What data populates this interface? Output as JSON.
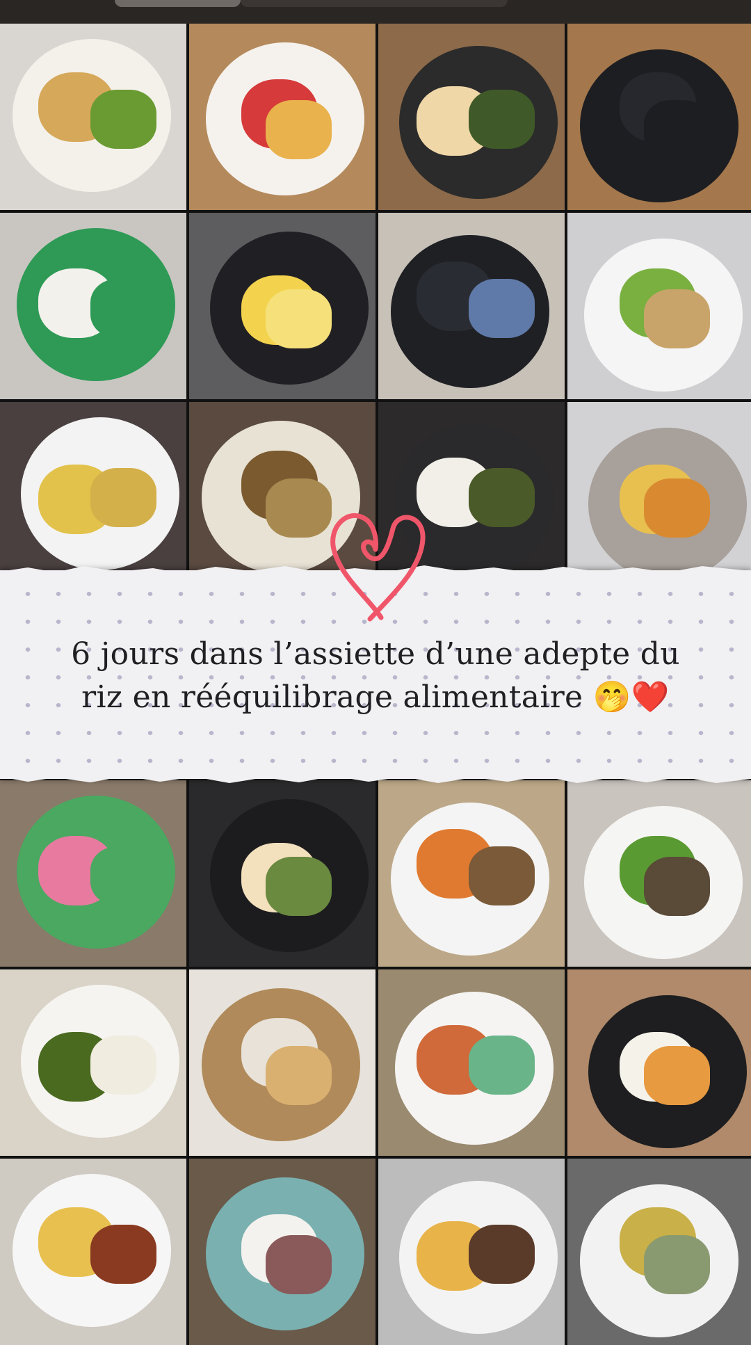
{
  "story": {
    "progress_fraction": 0.32,
    "caption_line1": "6 jours dans l’assiette d’une adepte du",
    "caption_line2": "riz en rééquilibrage alimentaire",
    "caption_emojis": "🤭❤️",
    "doodle_icon": "heart-doodle-icon"
  },
  "colors": {
    "banner_bg": "#f1f0f2",
    "dot": "#b8b6cc",
    "heart": "#f0566a",
    "text": "#1f1f24"
  },
  "tiles": [
    {
      "name": "meal-photo-chicken-salad-attieke",
      "bg": "#d9d6d2",
      "plate": "#f4f1ea",
      "food": "#d6a85a",
      "food2": "#6a9b32"
    },
    {
      "name": "meal-photo-omelette-watermelon",
      "bg": "#b48a5c",
      "plate": "#f5f2ee",
      "food": "#d63a3a",
      "food2": "#e9b24c"
    },
    {
      "name": "meal-photo-flan-greens",
      "bg": "#8c6a4a",
      "plate": "#2b2b2b",
      "food": "#f0d7a8",
      "food2": "#3f5a28"
    },
    {
      "name": "photo-empty-black-plate",
      "bg": "#a4784c",
      "plate": "#1d1e22",
      "food": "#26282d",
      "food2": "#1d1e22"
    },
    {
      "name": "photo-yogurt-dolait-nature",
      "bg": "#c9c6c2",
      "plate": "#2e9a55",
      "food": "#f3f1ec",
      "food2": "#2e9a55"
    },
    {
      "name": "meal-photo-pineapple-slices",
      "bg": "#5d5d60",
      "plate": "#202024",
      "food": "#f3d34e",
      "food2": "#f6e07a"
    },
    {
      "name": "photo-bathroom-scale",
      "bg": "#c7c1b8",
      "plate": "#1f2024",
      "food": "#2a2c33",
      "food2": "#5f7aa8"
    },
    {
      "name": "meal-photo-fish-avocado-salad",
      "bg": "#cfcfd2",
      "plate": "#f5f5f5",
      "food": "#7ab040",
      "food2": "#c9a46a"
    },
    {
      "name": "meal-photo-noodles-vegetables",
      "bg": "#4a4040",
      "plate": "#f3f3f3",
      "food": "#e2c24a",
      "food2": "#d3b04a"
    },
    {
      "name": "meal-photo-beans-plate",
      "bg": "#5a4a40",
      "plate": "#e8e2d4",
      "food": "#7b5a30",
      "food2": "#a88a50"
    },
    {
      "name": "meal-photo-rice-greens",
      "bg": "#2c2a2a",
      "plate": "#2a2a2c",
      "food": "#f2efe8",
      "food2": "#4a5a28"
    },
    {
      "name": "meal-photo-couscous-stew",
      "bg": "#d2d2d4",
      "plate": "#a8a09a",
      "food": "#e8c050",
      "food2": "#d98a30"
    },
    {
      "name": "photo-compote-pouch",
      "bg": "#8a7a6a",
      "plate": "#4aa860",
      "food": "#e87aa0",
      "food2": "#4aa860"
    },
    {
      "name": "meal-photo-flan-cabbage",
      "bg": "#2a2a2c",
      "plate": "#1c1c1e",
      "food": "#f3e0bd",
      "food2": "#6a8a40"
    },
    {
      "name": "meal-photo-sweet-potato-stew",
      "bg": "#bca888",
      "plate": "#f4f4f4",
      "food": "#e07a30",
      "food2": "#7a5a38"
    },
    {
      "name": "meal-photo-meat-salad",
      "bg": "#c9c4be",
      "plate": "#f5f5f3",
      "food": "#5a9a32",
      "food2": "#5a4a38"
    },
    {
      "name": "meal-photo-leaf-sauce",
      "bg": "#d9d3c8",
      "plate": "#f5f4f0",
      "food": "#4a6a20",
      "food2": "#f0ece0"
    },
    {
      "name": "photo-tea-toast-table",
      "bg": "#e7e3dc",
      "plate": "#b08a5a",
      "food": "#e8e2d8",
      "food2": "#d9b070"
    },
    {
      "name": "meal-photo-porridge-sauce",
      "bg": "#9a8a70",
      "plate": "#f5f4f2",
      "food": "#d06a3a",
      "food2": "#6ab48a"
    },
    {
      "name": "meal-photo-rice-fish-stew",
      "bg": "#b08a6a",
      "plate": "#1e1e20",
      "food": "#f5f2ea",
      "food2": "#e89a40"
    },
    {
      "name": "meal-photo-rice-chicken",
      "bg": "#cfcac2",
      "plate": "#f6f6f6",
      "food": "#e8c050",
      "food2": "#8a3a20"
    },
    {
      "name": "meal-photo-foufou-greens",
      "bg": "#6a5a4a",
      "plate": "#7ab0b0",
      "food": "#f4f2ee",
      "food2": "#8a5a5a"
    },
    {
      "name": "meal-photo-rice-onions",
      "bg": "#bcbcbc",
      "plate": "#f3f3f3",
      "food": "#e8b44a",
      "food2": "#5a3a28"
    },
    {
      "name": "meal-photo-couscous-spoon",
      "bg": "#6a6a6a",
      "plate": "#f2f2f2",
      "food": "#c9b048",
      "food2": "#8a9a70"
    }
  ]
}
